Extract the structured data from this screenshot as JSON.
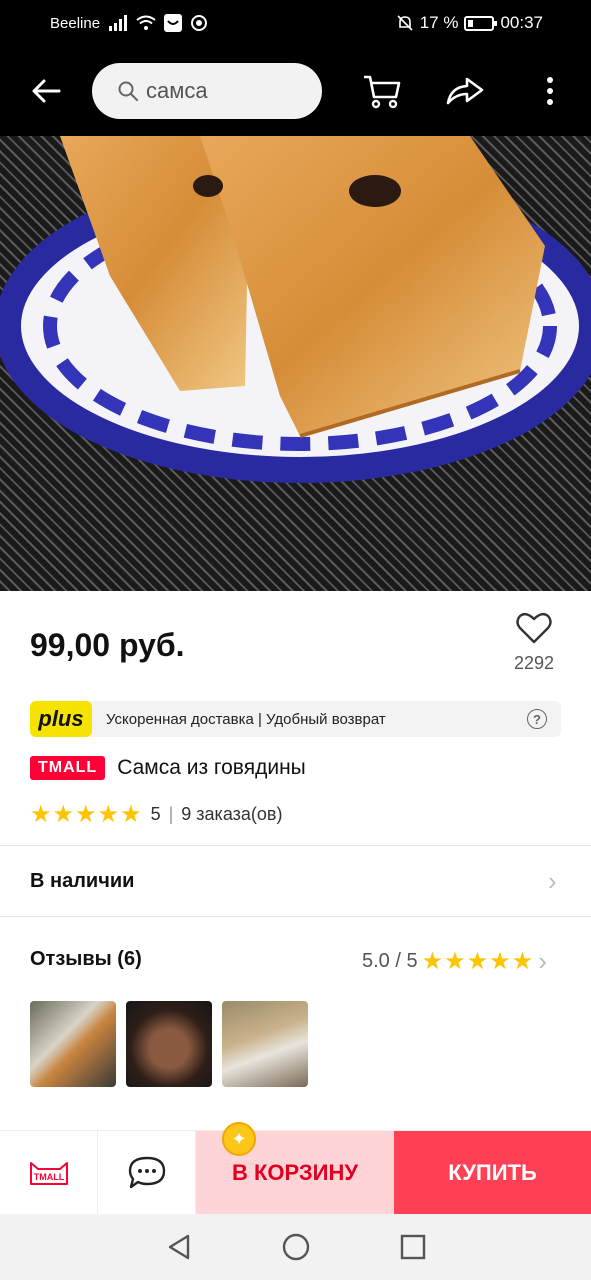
{
  "status_bar": {
    "carrier": "Beeline",
    "battery": "17 %",
    "time": "00:37"
  },
  "top_bar": {
    "search_query": "самса"
  },
  "product": {
    "price": "99,00 руб.",
    "favorites_count": "2292",
    "plus_label": "plus",
    "plus_text": "Ускоренная доставка | Удобный возврат",
    "store_badge": "TMALL",
    "title": "Самса из говядины",
    "stars": "★★★★★",
    "rating": "5",
    "orders": "9 заказа(ов)"
  },
  "availability": {
    "label": "В наличии"
  },
  "reviews": {
    "label": "Отзывы (6)",
    "score": "5.0 / 5",
    "stars": "★★★★★"
  },
  "action_bar": {
    "store_label": "TMALL",
    "cart_label": "В КОРЗИНУ",
    "buy_label": "КУПИТЬ"
  },
  "colors": {
    "accent": "#fe4054",
    "cart_bg": "#ffd4d6",
    "plus_yellow": "#f6e400",
    "star": "#ffc400"
  }
}
